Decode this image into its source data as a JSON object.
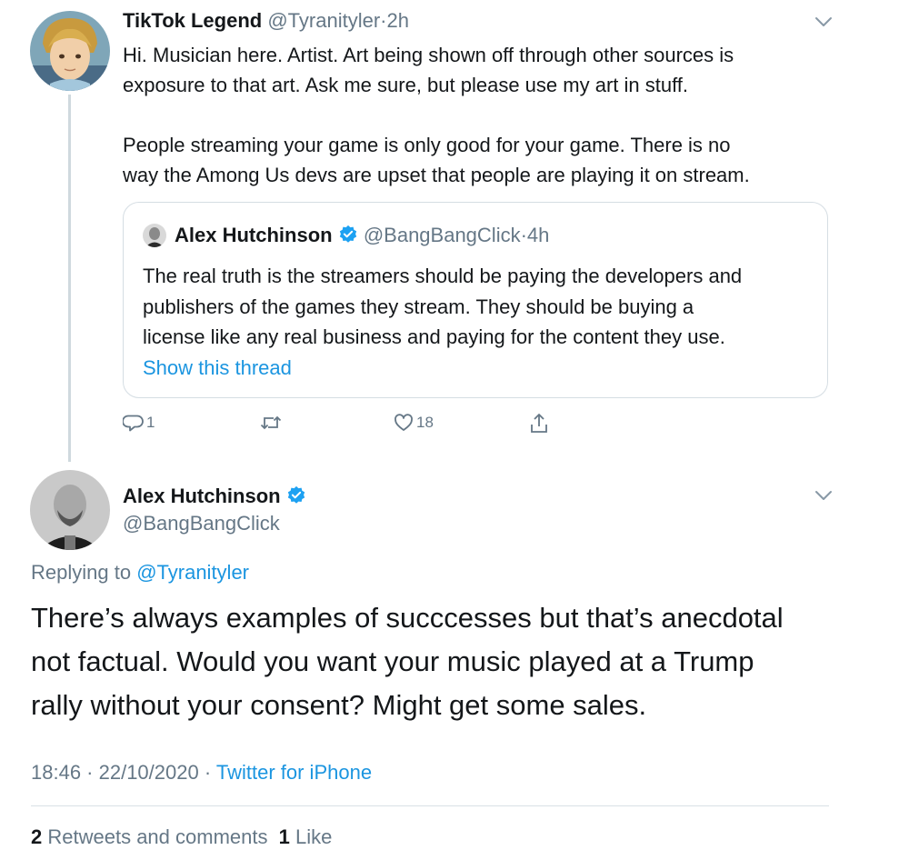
{
  "parent_tweet": {
    "author_name": "TikTok Legend",
    "handle": "@Tyranityler",
    "sep": "·",
    "time": "2h",
    "text_line1": "Hi. Musician here. Artist. Art being shown off through other sources is",
    "text_line2": "exposure to that art. Ask me sure, but please use my art in stuff.",
    "text_line3": "People streaming your game is only good for your game. There is no",
    "text_line4": "way the Among Us devs are upset that people are playing it on stream.",
    "reply_count": "1",
    "like_count": "18",
    "icons": [
      "reply-icon",
      "retweet-icon",
      "like-icon",
      "share-icon",
      "chevron-down-icon"
    ]
  },
  "quoted_tweet": {
    "author_name": "Alex Hutchinson",
    "handle": "@BangBangClick",
    "sep": "·",
    "time": "4h",
    "text_line1": "The real truth is the streamers should be paying the developers and",
    "text_line2": "publishers of the games they stream. They should be buying a",
    "text_line3": "license like any real business and paying for the content they use.",
    "show_thread": "Show this thread"
  },
  "main_tweet": {
    "author_name": "Alex Hutchinson",
    "handle": "@BangBangClick",
    "replying_to_label": "Replying to",
    "replying_to_handle": "@Tyranityler",
    "text_line1": "There’s always examples of succcesses but that’s anecdotal",
    "text_line2": "not factual. Would you want your music played at a Trump",
    "text_line3": "rally without your consent? Might get some sales.",
    "timestamp": "18:46 · 22/10/2020 ·",
    "client": "Twitter for iPhone",
    "retweets_count": "2",
    "retweets_label": "Retweets and comments",
    "likes_count": "1",
    "likes_label": "Like"
  },
  "colors": {
    "link": "#1b95e0",
    "muted": "#657786",
    "verified": "#1da1f2",
    "thread_line": "#cfd9de"
  }
}
